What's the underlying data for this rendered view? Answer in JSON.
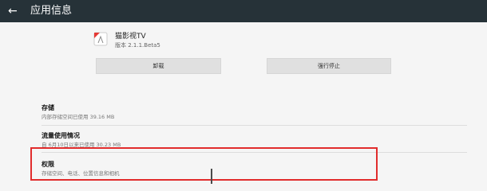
{
  "header": {
    "title": "应用信息"
  },
  "app": {
    "name": "猫影视TV",
    "version": "版本 2.1.1.Beta5",
    "icon": "app-icon"
  },
  "buttons": {
    "uninstall": "卸载",
    "force_stop": "强行停止"
  },
  "rows": [
    {
      "title": "存储",
      "subtitle": "内部存储空间已使用 39.16 MB"
    },
    {
      "title": "流量使用情况",
      "subtitle": "自 6月10日以来已使用 30.23 MB"
    },
    {
      "title": "权限",
      "subtitle": "存储空间、电话、位置信息和相机"
    }
  ],
  "colors": {
    "topbar": "#263238",
    "highlight": "#e12c2c",
    "button": "#e0e0e0"
  }
}
